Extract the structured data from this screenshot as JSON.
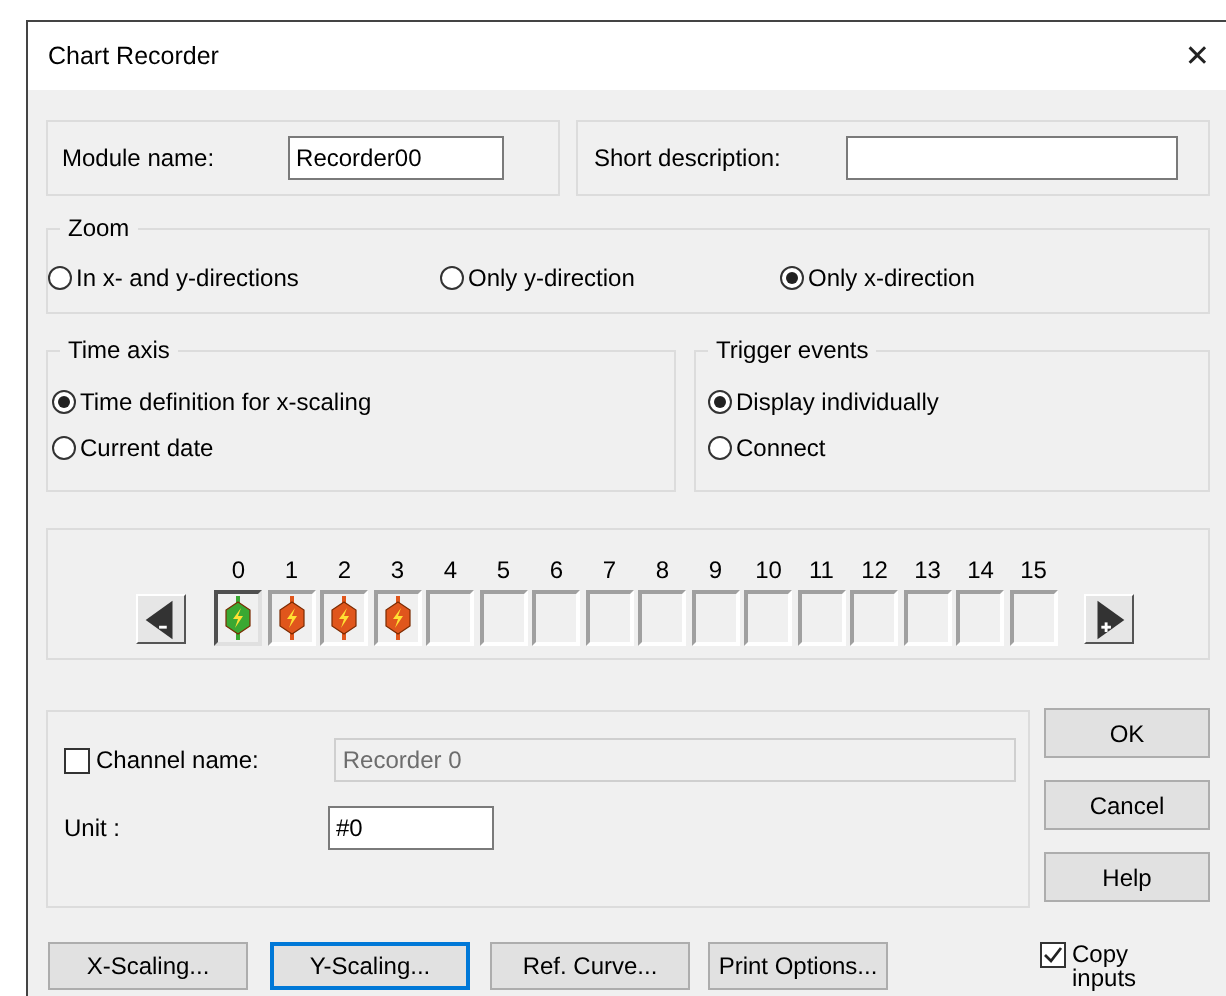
{
  "window": {
    "title": "Chart Recorder",
    "close": "✕"
  },
  "module": {
    "label": "Module name:",
    "value": "Recorder00"
  },
  "short_description": {
    "label": "Short description:"
  },
  "zoom": {
    "title": "Zoom",
    "options": [
      {
        "label": "In x- and y-directions",
        "selected": false
      },
      {
        "label": "Only y-direction",
        "selected": false
      },
      {
        "label": "Only x-direction",
        "selected": true
      }
    ]
  },
  "time_axis": {
    "title": "Time axis",
    "options": [
      {
        "label": "Time definition for x-scaling",
        "selected": true
      },
      {
        "label": "Current date",
        "selected": false
      }
    ]
  },
  "trigger_events": {
    "title": "Trigger events",
    "options": [
      {
        "label": "Display individually",
        "selected": true
      },
      {
        "label": "Connect",
        "selected": false
      }
    ]
  },
  "channels": [
    {
      "number": "0",
      "kind": "active",
      "selected": true
    },
    {
      "number": "1",
      "kind": "assigned",
      "selected": false
    },
    {
      "number": "2",
      "kind": "assigned",
      "selected": false
    },
    {
      "number": "3",
      "kind": "assigned",
      "selected": false
    },
    {
      "number": "4",
      "kind": "empty",
      "selected": false
    },
    {
      "number": "5",
      "kind": "empty",
      "selected": false
    },
    {
      "number": "6",
      "kind": "empty",
      "selected": false
    },
    {
      "number": "7",
      "kind": "empty",
      "selected": false
    },
    {
      "number": "8",
      "kind": "empty",
      "selected": false
    },
    {
      "number": "9",
      "kind": "empty",
      "selected": false
    },
    {
      "number": "10",
      "kind": "empty",
      "selected": false
    },
    {
      "number": "11",
      "kind": "empty",
      "selected": false
    },
    {
      "number": "12",
      "kind": "empty",
      "selected": false
    },
    {
      "number": "13",
      "kind": "empty",
      "selected": false
    },
    {
      "number": "14",
      "kind": "empty",
      "selected": false
    },
    {
      "number": "15",
      "kind": "empty",
      "selected": false
    }
  ],
  "channel": {
    "name_label": "Channel name:",
    "name_checked": false,
    "name_value": "Recorder 0",
    "name_disabled": true,
    "unit_label": "Unit :",
    "unit_value": "#0"
  },
  "side_buttons": [
    {
      "label": "OK"
    },
    {
      "label": "Cancel"
    },
    {
      "label": "Help"
    }
  ],
  "bottom_buttons": [
    {
      "label": "X-Scaling...",
      "focused": false
    },
    {
      "label": "Y-Scaling...",
      "focused": true
    },
    {
      "label": "Ref. Curve...",
      "focused": false
    },
    {
      "label": "Print Options...",
      "focused": false
    }
  ],
  "copy_inputs": {
    "label": "Copy inputs",
    "checked": true
  }
}
